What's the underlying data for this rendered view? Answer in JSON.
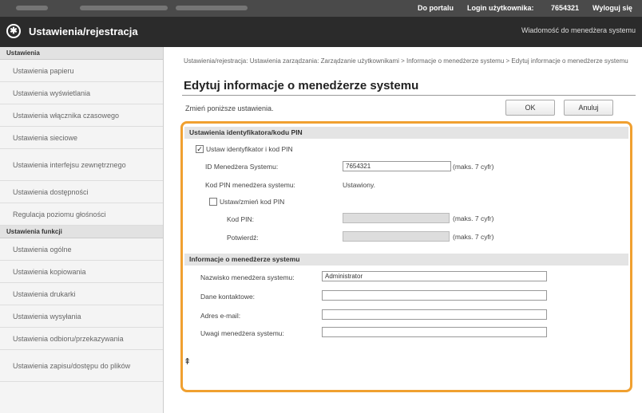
{
  "topbar": {
    "portal_link": "Do portalu",
    "login_label": "Login użytkownika:",
    "login_value": "7654321",
    "logout_link": "Wyloguj się"
  },
  "header": {
    "title": "Ustawienia/rejestracja",
    "message_link": "Wiadomość do menedżera systemu"
  },
  "sidebar": {
    "group1": "Ustawienia",
    "items1": [
      {
        "label": "Ustawienia papieru"
      },
      {
        "label": "Ustawienia wyświetlania"
      },
      {
        "label": "Ustawienia włącznika czasowego"
      },
      {
        "label": "Ustawienia sieciowe"
      },
      {
        "label": "Ustawienia interfejsu zewnętrznego"
      },
      {
        "label": "Ustawienia dostępności"
      },
      {
        "label": "Regulacja poziomu głośności"
      }
    ],
    "group2": "Ustawienia funkcji",
    "items2": [
      {
        "label": "Ustawienia ogólne"
      },
      {
        "label": "Ustawienia kopiowania"
      },
      {
        "label": "Ustawienia drukarki"
      },
      {
        "label": "Ustawienia wysyłania"
      },
      {
        "label": "Ustawienia odbioru/przekazywania"
      },
      {
        "label": "Ustawienia zapisu/dostępu do plików"
      }
    ]
  },
  "main": {
    "breadcrumb": "Ustawienia/rejestracja: Ustawienia zarządzania: Zarządzanie użytkownikami > Informacje o menedżerze systemu > Edytuj informacje o menedżerze systemu",
    "title": "Edytuj informacje o menedżerze systemu",
    "instruction": "Zmień poniższe ustawienia.",
    "ok_label": "OK",
    "cancel_label": "Anuluj"
  },
  "pin_section": {
    "title": "Ustawienia identyfikatora/kodu PIN",
    "set_id_pin_label": "Ustaw identyfikator i kod PIN",
    "set_id_pin_checked": true,
    "manager_id_label": "ID Menedżera Systemu:",
    "manager_id_value": "7654321",
    "manager_id_hint": "(maks. 7 cyfr)",
    "pin_status_label": "Kod PIN menedżera systemu:",
    "pin_status_value": "Ustawiony.",
    "change_pin_label": "Ustaw/zmień kod PIN",
    "change_pin_checked": false,
    "pin_label": "Kod PIN:",
    "pin_hint": "(maks. 7 cyfr)",
    "confirm_label": "Potwierdź:",
    "confirm_hint": "(maks. 7 cyfr)"
  },
  "info_section": {
    "title": "Informacje o menedżerze systemu",
    "name_label": "Nazwisko menedżera systemu:",
    "name_value": "Administrator",
    "contact_label": "Dane kontaktowe:",
    "contact_value": "",
    "email_label": "Adres e-mail:",
    "email_value": "",
    "comment_label": "Uwagi menedżera systemu:",
    "comment_value": ""
  },
  "colors": {
    "highlight": "#f0a030",
    "title_bar": "#2b2b2b",
    "top_bar": "#4a4a4a"
  }
}
